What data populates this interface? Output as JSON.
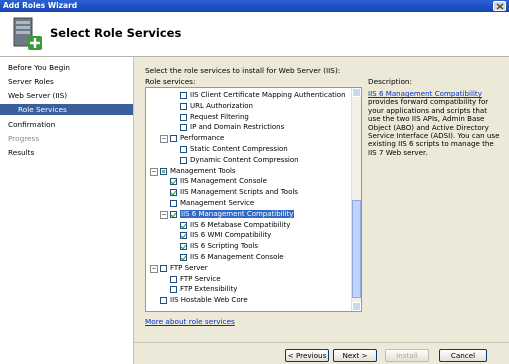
{
  "window": {
    "title": "Add Roles Wizard"
  },
  "header": {
    "title": "Select Role Services"
  },
  "nav": {
    "items": [
      {
        "label": "Before You Begin",
        "state": "normal"
      },
      {
        "label": "Server Roles",
        "state": "normal"
      },
      {
        "label": "Web Server (IIS)",
        "state": "normal"
      },
      {
        "label": "Role Services",
        "state": "selected"
      },
      {
        "label": "Confirmation",
        "state": "normal"
      },
      {
        "label": "Progress",
        "state": "disabled"
      },
      {
        "label": "Results",
        "state": "normal"
      }
    ]
  },
  "main": {
    "intro": "Select the role services to install for Web Server (IIS):",
    "services_label": "Role services:",
    "description_label": "Description:",
    "description_link": "IIS 6 Management Compatibility",
    "description_text": " provides forward compatibility for your applications and scripts that use the two IIS APIs, Admin Base Object (ABO) and Active Directory Service Interface (ADSI). You can use existing IIS 6 scripts to manage the IIS 7 Web server.",
    "more_link": "More about role services"
  },
  "tree": [
    {
      "label": "IIS Client Certificate Mapping Authentication",
      "indent": 3,
      "expander": "",
      "check": "unchecked"
    },
    {
      "label": "URL Authorization",
      "indent": 3,
      "expander": "",
      "check": "unchecked"
    },
    {
      "label": "Request Filtering",
      "indent": 3,
      "expander": "",
      "check": "unchecked"
    },
    {
      "label": "IP and Domain Restrictions",
      "indent": 3,
      "expander": "",
      "check": "unchecked"
    },
    {
      "label": "Performance",
      "indent": 2,
      "expander": "−",
      "check": "unchecked"
    },
    {
      "label": "Static Content Compression",
      "indent": 3,
      "expander": "",
      "check": "unchecked"
    },
    {
      "label": "Dynamic Content Compression",
      "indent": 3,
      "expander": "",
      "check": "unchecked"
    },
    {
      "label": "Management Tools",
      "indent": 1,
      "expander": "−",
      "check": "partial"
    },
    {
      "label": "IIS Management Console",
      "indent": 2,
      "expander": "",
      "check": "checked"
    },
    {
      "label": "IIS Management Scripts and Tools",
      "indent": 2,
      "expander": "",
      "check": "checked"
    },
    {
      "label": "Management Service",
      "indent": 2,
      "expander": "",
      "check": "unchecked"
    },
    {
      "label": "IIS 6 Management Compatibility",
      "indent": 2,
      "expander": "−",
      "check": "checked",
      "highlight": true
    },
    {
      "label": "IIS 6 Metabase Compatibility",
      "indent": 3,
      "expander": "",
      "check": "checked"
    },
    {
      "label": "IIS 6 WMI Compatibility",
      "indent": 3,
      "expander": "",
      "check": "checked"
    },
    {
      "label": "IIS 6 Scripting Tools",
      "indent": 3,
      "expander": "",
      "check": "checked"
    },
    {
      "label": "IIS 6 Management Console",
      "indent": 3,
      "expander": "",
      "check": "checked"
    },
    {
      "label": "FTP Server",
      "indent": 1,
      "expander": "−",
      "check": "unchecked"
    },
    {
      "label": "FTP Service",
      "indent": 2,
      "expander": "",
      "check": "unchecked"
    },
    {
      "label": "FTP Extensibility",
      "indent": 2,
      "expander": "",
      "check": "unchecked"
    },
    {
      "label": "IIS Hostable Web Core",
      "indent": 1,
      "expander": "",
      "check": "unchecked"
    }
  ],
  "buttons": {
    "previous": "< Previous",
    "next": "Next >",
    "install": "Install",
    "cancel": "Cancel"
  }
}
